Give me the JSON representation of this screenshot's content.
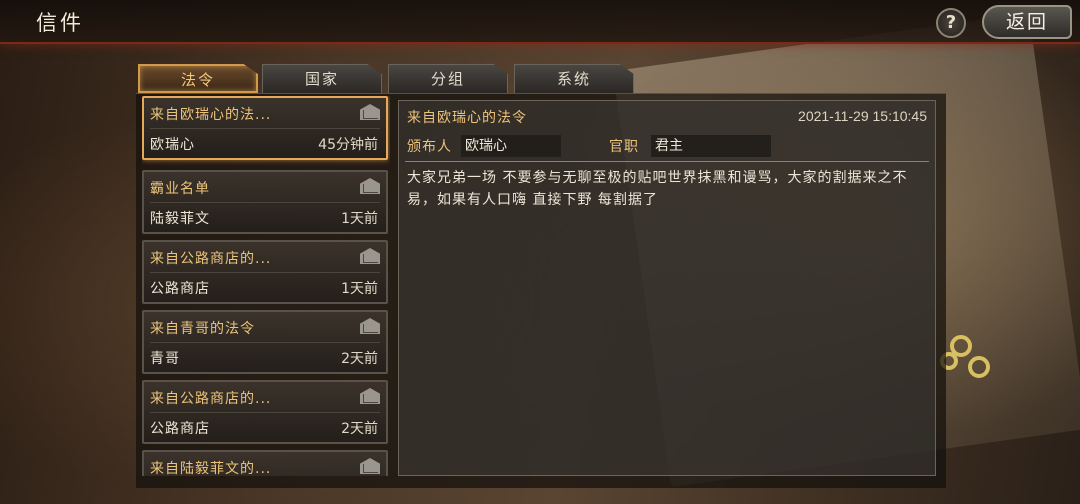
{
  "header": {
    "title": "信件",
    "help_label": "?",
    "back_label": "返回"
  },
  "tabs": [
    {
      "label": "法令",
      "active": true
    },
    {
      "label": "国家",
      "active": false
    },
    {
      "label": "分组",
      "active": false
    },
    {
      "label": "系统",
      "active": false
    }
  ],
  "mails": [
    {
      "subject": "来自欧瑞心的法...",
      "sender": "欧瑞心",
      "time": "45分钟前",
      "selected": true
    },
    {
      "subject": "霸业名单",
      "sender": "陆毅菲文",
      "time": "1天前",
      "selected": false
    },
    {
      "subject": "来自公路商店的...",
      "sender": "公路商店",
      "time": "1天前",
      "selected": false
    },
    {
      "subject": "来自青哥的法令",
      "sender": "青哥",
      "time": "2天前",
      "selected": false
    },
    {
      "subject": "来自公路商店的...",
      "sender": "公路商店",
      "time": "2天前",
      "selected": false
    },
    {
      "subject": "来自陆毅菲文的...",
      "sender": "",
      "time": "",
      "selected": false
    }
  ],
  "detail": {
    "title": "来自欧瑞心的法令",
    "date": "2021-11-29 15:10:45",
    "publisher_label": "颁布人",
    "publisher": "欧瑞心",
    "rank_label": "官职",
    "rank": "君主",
    "body": "大家兄弟一场 不要参与无聊至极的贴吧世界抹黑和谩骂，大家的割据来之不易，如果有人口嗨 直接下野 每割据了"
  },
  "colors": {
    "accent": "#ecc37a",
    "selected_border": "#e6a85a",
    "header_glow": "#7a2a18"
  }
}
